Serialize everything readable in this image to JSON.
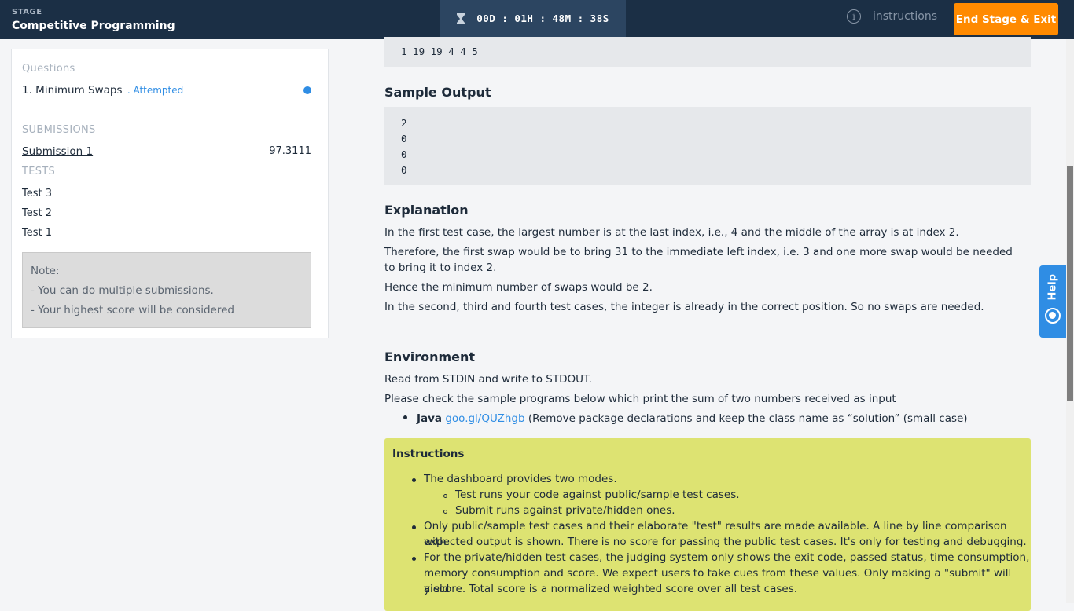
{
  "header": {
    "stage_label": "STAGE",
    "stage_name": "Competitive Programming",
    "timer": "00D : 01H : 48M : 38S",
    "instructions_label": "instructions",
    "end_button_label": "End Stage & Exit"
  },
  "sidebar": {
    "questions_heading": "Questions",
    "question": {
      "label": "1. Minimum Swaps",
      "status": ". Attempted"
    },
    "submissions_heading": "SUBMISSIONS",
    "submission": {
      "label": "Submission 1",
      "score": "97.3111"
    },
    "tests_heading": "TESTS",
    "tests": [
      "Test 3",
      "Test 2",
      "Test 1"
    ],
    "note": {
      "title": "Note:",
      "lines": [
        "- You can do multiple submissions.",
        "- Your highest score will be considered"
      ]
    }
  },
  "content": {
    "sample_input_tail": "1 19 19 4 4 5",
    "sample_output_heading": "Sample Output",
    "sample_output_lines": [
      "2",
      "0",
      "0",
      "0"
    ],
    "explanation_heading": "Explanation",
    "explanation_paragraphs": [
      "In the first test case, the largest number is at the last index, i.e., 4 and the middle of the array is at index 2.",
      "Therefore, the first swap would be to bring 31 to the immediate left index, i.e. 3 and one more swap would be needed to bring it to index 2.",
      "Hence the minimum number of swaps would be 2.",
      "In the second, third and fourth test cases, the integer is already in the correct position. So no swaps are needed."
    ],
    "environment_heading": "Environment",
    "environment_lines": [
      "Read from STDIN and write to STDOUT.",
      "Please check the sample programs below which print the sum of two numbers received as input"
    ],
    "java_item": {
      "lang": "Java",
      "link": "goo.gl/QUZhgb",
      "rest": "(Remove package declarations and keep the class name as “solution” (small case)"
    },
    "instructions_box": {
      "title": "Instructions",
      "b1": "The dashboard provides two modes.",
      "b1_sub1": "Test runs your code against public/sample test cases.",
      "b1_sub2": "Submit runs against private/hidden ones.",
      "b2_l1": "Only public/sample test cases and their elaborate \"test\" results are made available. A line by line comparison with",
      "b2_l2": "expected output is shown. There is no score for passing the public test cases. It's only for testing and debugging.",
      "b3_l1": "For the private/hidden test cases, the judging system only shows the exit code, passed status, time consumption,",
      "b3_l2": "memory consumption and score. We expect users to take cues from these values. Only making a \"submit\" will yield",
      "b3_l3": "a score. Total score is a normalized weighted score over all test cases."
    }
  },
  "help_tab": {
    "label": "Help"
  },
  "colors": {
    "topbar": "#1b2f45",
    "accent": "#2f8de4",
    "end_button": "#ff8a00",
    "instructions_bg": "#dde372"
  }
}
